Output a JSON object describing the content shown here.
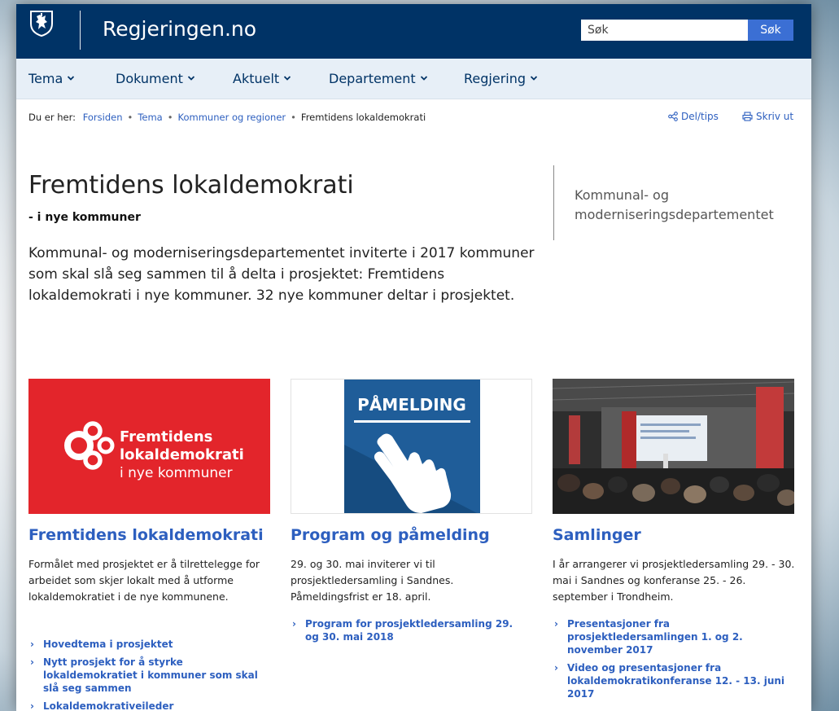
{
  "header": {
    "site_title": "Regjeringen.no",
    "search_placeholder": "Søk",
    "search_button": "Søk"
  },
  "nav": {
    "items": [
      "Tema",
      "Dokument",
      "Aktuelt",
      "Departement",
      "Regjering"
    ]
  },
  "breadcrumb": {
    "prefix": "Du er her:",
    "links": [
      "Forsiden",
      "Tema",
      "Kommuner og regioner"
    ],
    "current": "Fremtidens lokaldemokrati"
  },
  "tools": {
    "share": "Del/tips",
    "print": "Skriv ut"
  },
  "article": {
    "title": "Fremtidens lokaldemokrati",
    "subtitle": "- i nye kommuner",
    "lead": "Kommunal- og moderniseringsdepartementet inviterte i 2017 kommuner som skal slå seg sammen til å delta i prosjektet: Fremtidens lokaldemokrati i nye kommuner. 32 nye kommuner deltar i prosjektet.",
    "department": "Kommunal- og moderniseringsdepartementet"
  },
  "cards": [
    {
      "image_text": [
        "Fremtidens",
        "lokaldemokrati",
        "i nye kommuner"
      ],
      "title": "Fremtidens lokaldemokrati",
      "description": "Formålet med prosjektet er å tilrettelegge for arbeidet som skjer lokalt med å utforme lokaldemokratiet i de nye kommunene.",
      "links": [
        "Hovedtema i prosjektet",
        "Nytt prosjekt for å styrke lokaldemokratiet i kommuner som skal slå seg sammen",
        "Lokaldemokrativeileder"
      ]
    },
    {
      "image_text": "PÅMELDING",
      "title": "Program og påmelding",
      "description": "29. og 30. mai inviterer vi til prosjektledersamling i Sandnes. Påmeldingsfrist er 18. april.",
      "links": [
        "Program for prosjektledersamling 29. og 30. mai 2018"
      ]
    },
    {
      "title": "Samlinger",
      "description": "I år arrangerer vi prosjektledersamling 29. - 30. mai i Sandnes og konferanse 25. - 26. september i Trondheim.",
      "links": [
        "Presentasjoner fra prosjektledersamlingen 1. og 2. november 2017",
        "Video og presentasjoner fra lokaldemokratikonferanse 12. - 13. juni 2017"
      ]
    }
  ],
  "colors": {
    "header_bg": "#003366",
    "nav_bg": "#e7eff7",
    "link": "#2d5fbf",
    "brand_red": "#e3252b",
    "search_button": "#3b6fd4"
  },
  "icons": [
    "coat-of-arms-icon",
    "chevron-down-icon",
    "share-icon",
    "print-icon",
    "arrow-right-icon"
  ]
}
